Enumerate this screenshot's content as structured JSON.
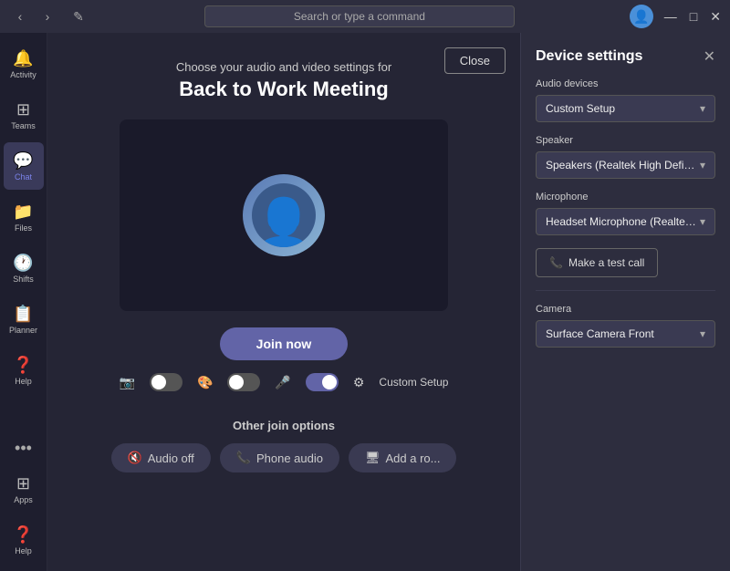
{
  "titlebar": {
    "search_placeholder": "Search or type a command",
    "nav_back": "‹",
    "nav_forward": "›",
    "edit_icon": "✎",
    "minimize": "—",
    "maximize": "□",
    "close": "✕"
  },
  "sidebar": {
    "items": [
      {
        "id": "activity",
        "label": "Activity",
        "icon": "🔔"
      },
      {
        "id": "teams",
        "label": "Teams",
        "icon": "⊞"
      },
      {
        "id": "chat",
        "label": "Chat",
        "icon": "💬",
        "active": true
      },
      {
        "id": "files",
        "label": "Files",
        "icon": "📁"
      },
      {
        "id": "shifts",
        "label": "Shifts",
        "icon": "🕐"
      },
      {
        "id": "planner",
        "label": "Planner",
        "icon": "📋"
      },
      {
        "id": "help",
        "label": "Help",
        "icon": "?"
      }
    ],
    "bottom": [
      {
        "id": "apps",
        "label": "Apps",
        "icon": "⊞"
      },
      {
        "id": "help2",
        "label": "Help",
        "icon": "?"
      }
    ],
    "more_dots": "•••"
  },
  "meeting": {
    "subtitle": "Choose your audio and video settings for",
    "title": "Back to Work Meeting",
    "close_label": "Close",
    "join_label": "Join now",
    "other_join_label": "Other join options",
    "join_options": [
      {
        "id": "audio-off",
        "label": "Audio off",
        "icon": "🔇"
      },
      {
        "id": "phone-audio",
        "label": "Phone audio",
        "icon": "📞"
      },
      {
        "id": "add-room",
        "label": "Add a ro...",
        "icon": "🖥"
      }
    ],
    "custom_setup_label": "Custom Setup"
  },
  "device_settings": {
    "title": "Device settings",
    "audio_devices_label": "Audio devices",
    "audio_device_value": "Custom Setup",
    "speaker_label": "Speaker",
    "speaker_value": "Speakers (Realtek High Definition Au...",
    "microphone_label": "Microphone",
    "microphone_value": "Headset Microphone (Realtek High D...",
    "test_call_label": "Make a test call",
    "camera_label": "Camera",
    "camera_value": "Surface Camera Front"
  }
}
